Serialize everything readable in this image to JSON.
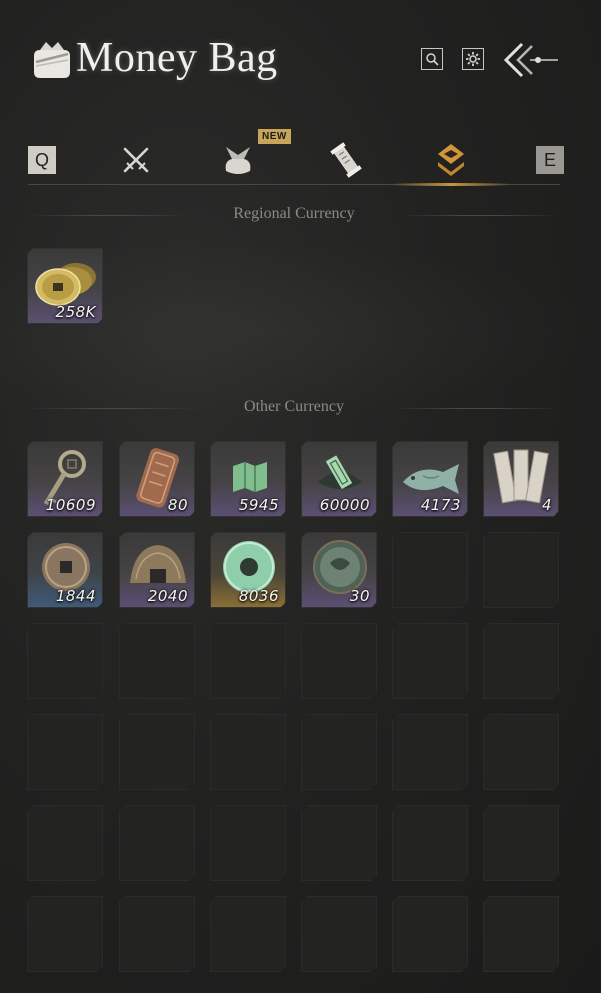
{
  "header": {
    "title": "Money Bag",
    "icons": [
      "money-bag-icon",
      "search-icon",
      "settings-gear-icon",
      "back-arrows-icon"
    ]
  },
  "tabs": {
    "prev_key": "Q",
    "next_key": "E",
    "new_badge": "NEW",
    "items": [
      {
        "icon": "crossed-swords-icon",
        "active": false
      },
      {
        "icon": "bundle-bag-icon",
        "active": false
      },
      {
        "icon": "scroll-icon",
        "active": false
      },
      {
        "icon": "currency-chevron-icon",
        "active": true
      }
    ],
    "active_color": "#c9963c"
  },
  "regional": {
    "label": "Regional Currency",
    "items": [
      {
        "icon": "gold-coins-icon",
        "count": "258K"
      }
    ]
  },
  "other": {
    "label": "Other Currency",
    "items": [
      {
        "icon": "key-coin-icon",
        "count": "10609"
      },
      {
        "icon": "bronze-tablet-icon",
        "count": "80"
      },
      {
        "icon": "jade-map-icon",
        "count": "5945"
      },
      {
        "icon": "green-token-icon",
        "count": "60000"
      },
      {
        "icon": "jade-fish-icon",
        "count": "4173"
      },
      {
        "icon": "paper-notes-icon",
        "count": "4"
      },
      {
        "icon": "square-hole-coin-icon",
        "count": "1844"
      },
      {
        "icon": "spade-coin-icon",
        "count": "2040"
      },
      {
        "icon": "jade-disc-icon",
        "count": "8036"
      },
      {
        "icon": "green-medallion-icon",
        "count": "30"
      }
    ]
  }
}
